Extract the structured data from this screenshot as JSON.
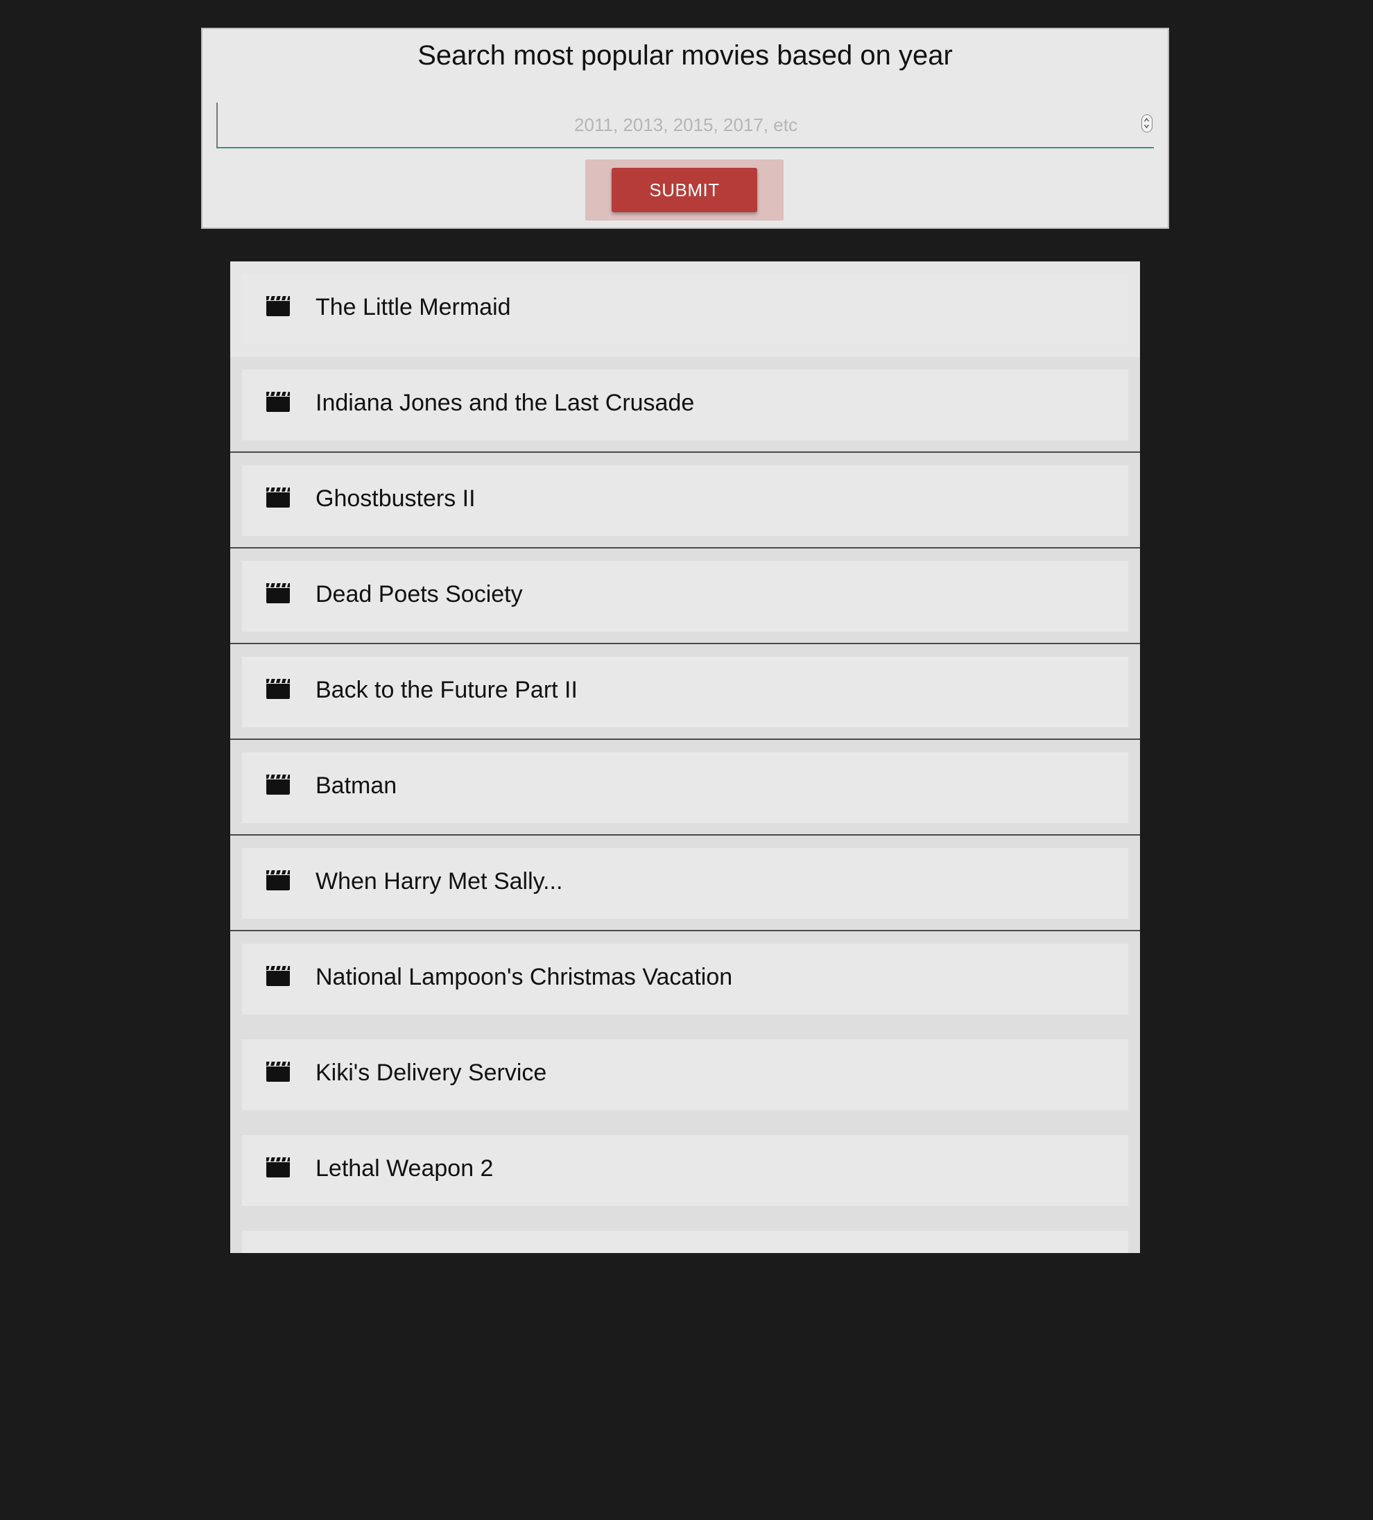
{
  "search": {
    "title": "Search most popular movies based on year",
    "placeholder": "2011, 2013, 2015, 2017, etc",
    "value": "",
    "submit_label": "SUBMIT"
  },
  "results": {
    "icon": "film-clapper-icon",
    "movies": [
      {
        "title": "The Little Mermaid"
      },
      {
        "title": "Indiana Jones and the Last Crusade"
      },
      {
        "title": "Ghostbusters II"
      },
      {
        "title": "Dead Poets Society"
      },
      {
        "title": "Back to the Future Part II"
      },
      {
        "title": "Batman"
      },
      {
        "title": "When Harry Met Sally..."
      },
      {
        "title": "National Lampoon's Christmas Vacation"
      },
      {
        "title": "Kiki's Delivery Service"
      },
      {
        "title": "Lethal Weapon 2"
      }
    ]
  },
  "colors": {
    "background": "#1b1b1b",
    "panel": "#e8e8e8",
    "submit": "#b53c38",
    "input_underline": "#3f8c8c"
  }
}
